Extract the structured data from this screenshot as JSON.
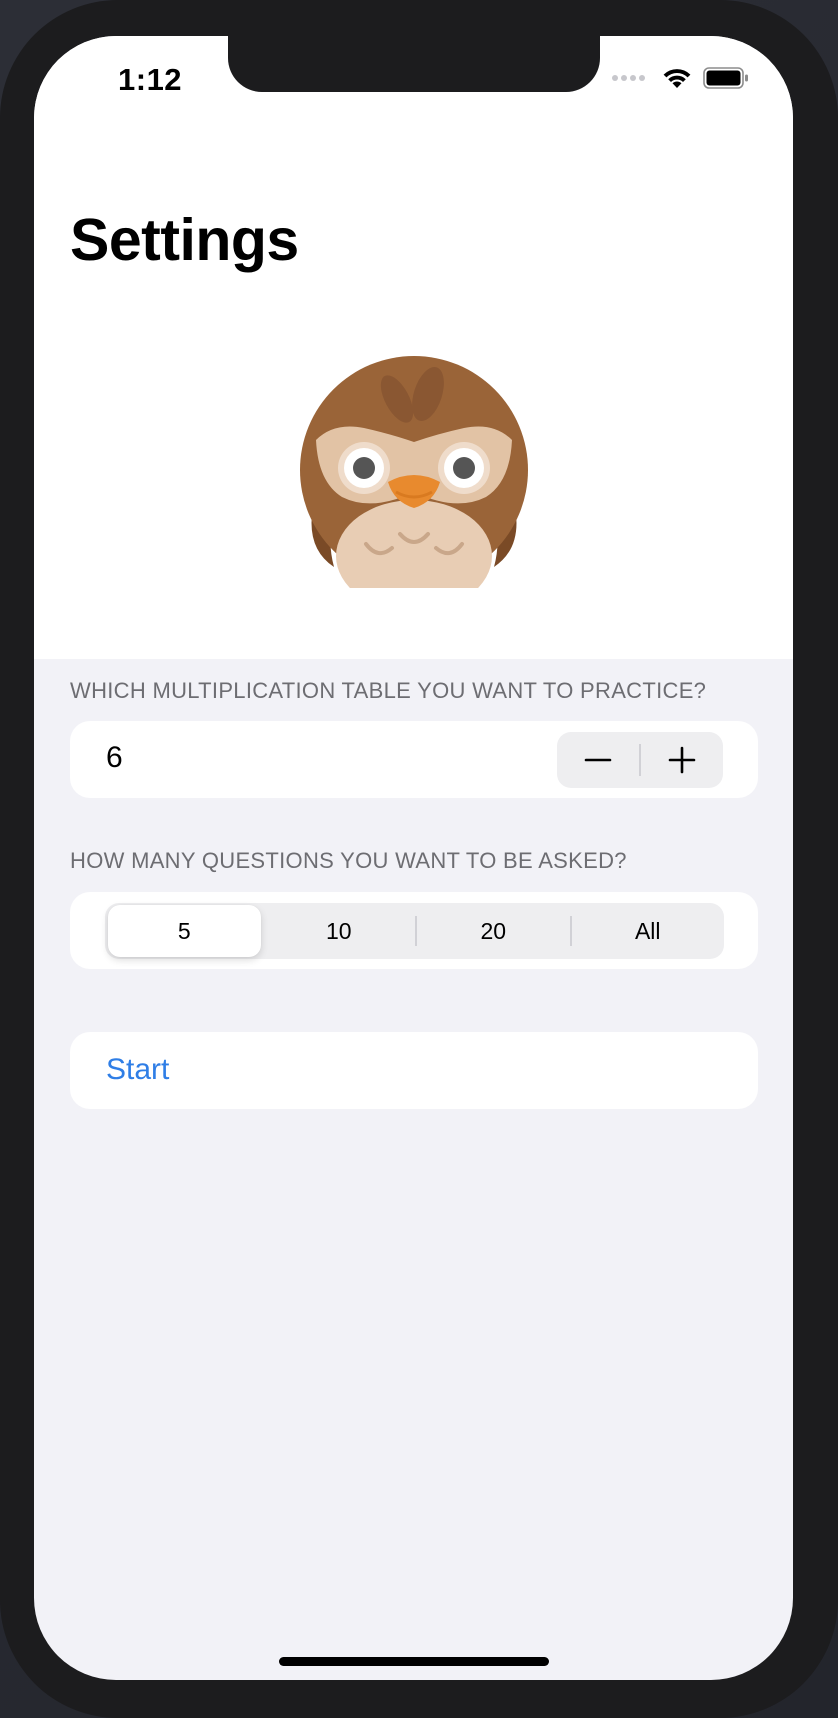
{
  "status_bar": {
    "time": "1:12",
    "icons": [
      "cellular-signal-icon",
      "wifi-icon",
      "battery-icon"
    ]
  },
  "header": {
    "title": "Settings"
  },
  "owl_image": {
    "icon": "owl-avatar-icon"
  },
  "table_section": {
    "header": "WHICH MULTIPLICATION TABLE YOU WANT TO PRACTICE?",
    "value": "6",
    "decrement_icon": "minus-icon",
    "increment_icon": "plus-icon"
  },
  "questions_section": {
    "header": "HOW MANY QUESTIONS YOU WANT TO BE ASKED?",
    "options": [
      "5",
      "10",
      "20",
      "All"
    ],
    "selected_index": 0
  },
  "start_section": {
    "label": "Start"
  },
  "colors": {
    "accent": "#2f7ee6",
    "background": "#f2f2f7",
    "card": "#ffffff",
    "section_header_text": "#6d6d72"
  }
}
